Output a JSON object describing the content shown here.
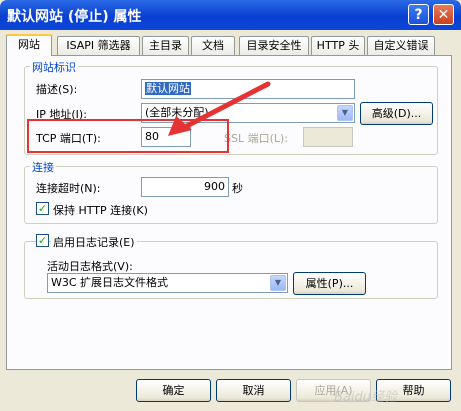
{
  "window": {
    "title": "默认网站 (停止) 属性",
    "help_glyph": "?",
    "close_glyph": "✕"
  },
  "tabs": [
    "网站",
    "ISAPI 筛选器",
    "主目录",
    "文档",
    "目录安全性",
    "HTTP 头",
    "自定义错误"
  ],
  "site_identity": {
    "group_label": "网站标识",
    "description_label": "描述(S):",
    "description_value": "默认网站",
    "ip_label": "IP 地址(I):",
    "ip_value": "(全部未分配)",
    "advanced_button": "高级(D)...",
    "tcp_port_label": "TCP 端口(T):",
    "tcp_port_value": "80",
    "ssl_port_label": "SSL 端口(L):",
    "ssl_port_value": ""
  },
  "connections": {
    "group_label": "连接",
    "timeout_label": "连接超时(N):",
    "timeout_value": "900",
    "timeout_unit": "秒",
    "keepalive_label": "保持 HTTP 连接(K)",
    "keepalive_checked": true
  },
  "logging": {
    "enable_label": "启用日志记录(E)",
    "enable_checked": true,
    "format_label": "活动日志格式(V):",
    "format_value": "W3C 扩展日志文件格式",
    "properties_button": "属性(P)..."
  },
  "footer": {
    "ok": "确定",
    "cancel": "取消",
    "apply": "应用(A)",
    "help": "帮助"
  },
  "annotation": {
    "highlight_color": "#e53333"
  },
  "watermark": "Baidu经验"
}
